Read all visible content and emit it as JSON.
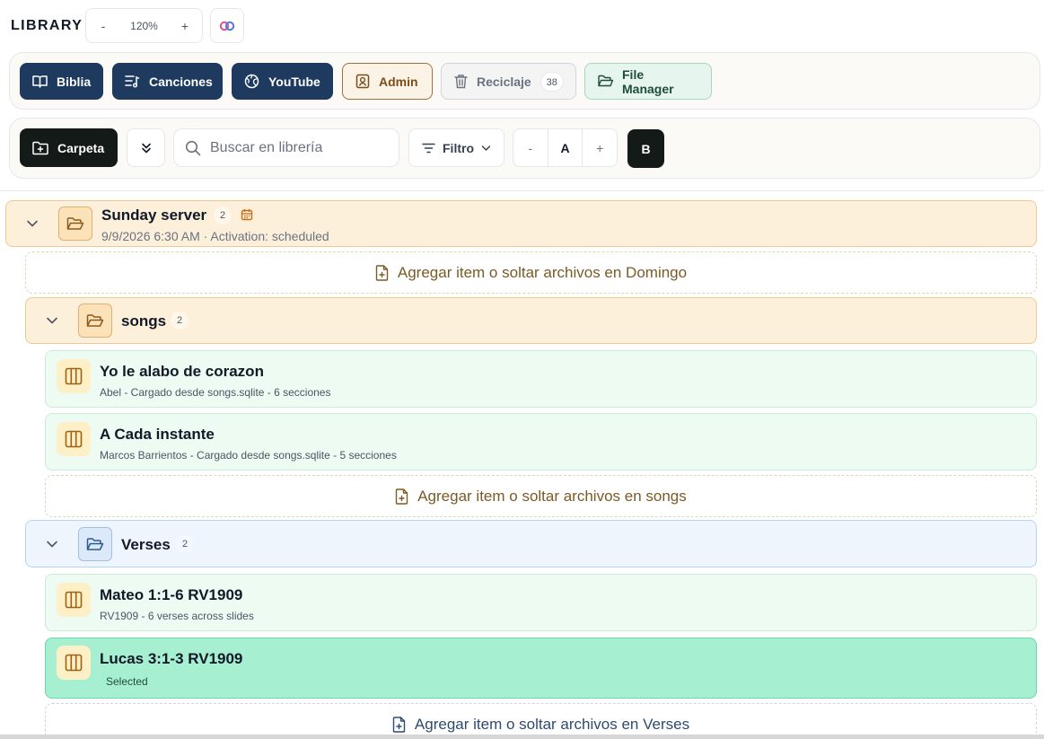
{
  "header": {
    "title": "LIBRARY",
    "zoom": {
      "minus": "-",
      "value": "120%",
      "plus": "+"
    },
    "link_icon": "link-icon"
  },
  "nav": {
    "biblia": "Biblia",
    "canciones": "Canciones",
    "youtube": "YouTube",
    "admin": "Admin",
    "reciclaje": "Reciclaje",
    "reciclaje_count": "38",
    "file_manager": "File Manager"
  },
  "toolbar": {
    "carpeta": "Carpeta",
    "search_placeholder": "Buscar en librería",
    "filtro": "Filtro",
    "font_minus": "-",
    "font_a": "A",
    "font_plus": "+",
    "bold": "B"
  },
  "tree": {
    "root": {
      "name": "Sunday server",
      "count": "2",
      "meta": "9/9/2026 6:30 AM · Activation: scheduled",
      "dropzone": "Agregar item o soltar archivos en Domingo"
    },
    "songs": {
      "name": "songs",
      "count": "2",
      "items": [
        {
          "title": "Yo le alabo de corazon",
          "subtitle": "Abel - Cargado desde songs.sqlite - 6 secciones"
        },
        {
          "title": "A Cada instante",
          "subtitle": "Marcos Barrientos - Cargado desde songs.sqlite - 5 secciones"
        }
      ],
      "dropzone": "Agregar item o soltar archivos en songs"
    },
    "verses": {
      "name": "Verses",
      "count": "2",
      "items": [
        {
          "title": "Mateo 1:1-6 RV1909",
          "subtitle": "RV1909 - 6 verses across slides"
        },
        {
          "title": "Lucas 3:1-3 RV1909",
          "subtitle": "Selected"
        }
      ],
      "dropzone": "Agregar item o soltar archivos en Verses"
    }
  },
  "colors": {
    "nav_dark": "#1e3a5f",
    "button_black": "#141a17",
    "folder_amber": "#fdf0db",
    "folder_blue": "#eef5fd",
    "item_green": "#edfbf3",
    "item_selected": "#a6f0d1"
  }
}
